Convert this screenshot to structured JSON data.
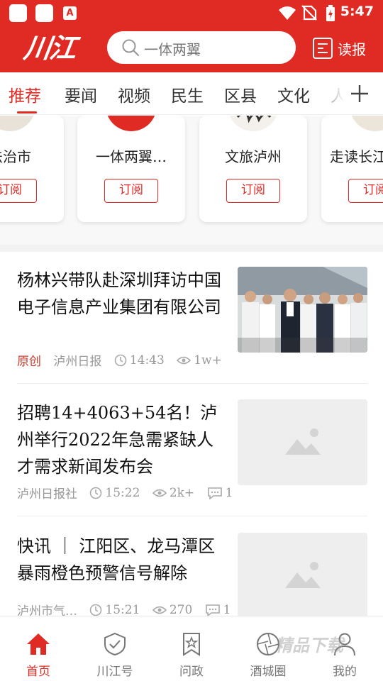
{
  "status_bar": {
    "time": "5:47",
    "notification_letter": "A"
  },
  "header": {
    "logo_text": "川江",
    "search_placeholder": "一体两翼",
    "read_paper_label": "读报"
  },
  "tabs": [
    {
      "label": "推荐",
      "active": true
    },
    {
      "label": "要闻",
      "active": false
    },
    {
      "label": "视频",
      "active": false
    },
    {
      "label": "民生",
      "active": false
    },
    {
      "label": "区县",
      "active": false
    },
    {
      "label": "文化",
      "active": false
    },
    {
      "label": "人",
      "active": false
    }
  ],
  "subscription_cards": [
    {
      "name": "法治市",
      "button": "订阅"
    },
    {
      "name": "一体两翼…",
      "button": "订阅"
    },
    {
      "name": "文旅泸州",
      "button": "订阅"
    },
    {
      "name": "走读长江",
      "button": "订阅"
    }
  ],
  "news": [
    {
      "title": "杨林兴带队赴深圳拜访中国电子信息产业集团有限公司",
      "tag": "原创",
      "source": "泸州日报",
      "time": "14:43",
      "views": "1w+",
      "comments": "",
      "has_photo": true
    },
    {
      "title": "招聘14+4063+54名！泸州举行2022年急需紧缺人才需求新闻发布会",
      "tag": "",
      "source": "泸州日报社",
      "time": "15:22",
      "views": "2k+",
      "comments": "1",
      "has_photo": false
    },
    {
      "title": "快讯 ｜ 江阳区、龙马潭区暴雨橙色预警信号解除",
      "tag": "",
      "source": "泸州市气…",
      "time": "15:21",
      "views": "270",
      "comments": "1",
      "has_photo": false
    }
  ],
  "bottom_nav": [
    {
      "label": "首页",
      "icon": "home-icon",
      "active": true
    },
    {
      "label": "川江号",
      "icon": "shield-check-icon",
      "active": false
    },
    {
      "label": "问政",
      "icon": "bookmark-star-icon",
      "active": false
    },
    {
      "label": "酒城圈",
      "icon": "aperture-icon",
      "active": false
    },
    {
      "label": "我的",
      "icon": "user-icon",
      "active": false
    }
  ],
  "watermark": "精品下载",
  "colors": {
    "brand_red": "#e02a24",
    "meta_gray": "#999999",
    "placeholder_gray": "#eeeeee"
  }
}
